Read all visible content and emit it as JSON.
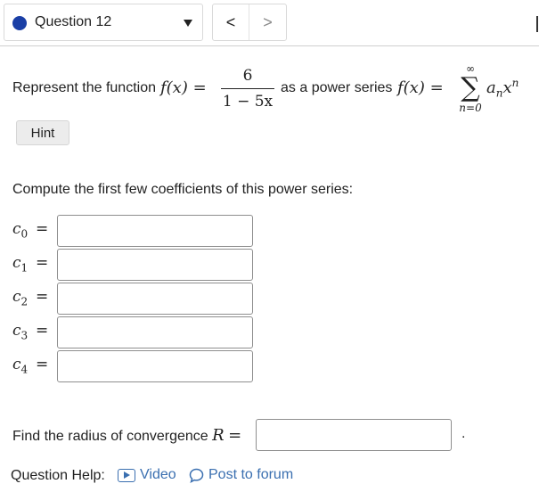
{
  "question_nav": {
    "status_color": "#1a3fa6",
    "label": "Question 12",
    "prev_symbol": "<",
    "next_symbol": ">"
  },
  "problem": {
    "prompt_prefix": "Represent the function",
    "f_of_x": "f(x) =",
    "fraction_numerator": "6",
    "fraction_denominator": "1 − 5x",
    "prompt_middle": "as a power series",
    "f_of_x_2": "f(x) =",
    "sum_upper": "∞",
    "sum_symbol": "∑",
    "sum_lower": "n=0",
    "term": "a",
    "term_sub": "n",
    "term_x": "x",
    "term_sup": "n"
  },
  "hint": {
    "label": "Hint"
  },
  "coefficients": {
    "instruction": "Compute the first few coefficients of this power series:",
    "items": [
      {
        "symbol": "c",
        "sub": "0",
        "eq": "=",
        "value": ""
      },
      {
        "symbol": "c",
        "sub": "1",
        "eq": "=",
        "value": ""
      },
      {
        "symbol": "c",
        "sub": "2",
        "eq": "=",
        "value": ""
      },
      {
        "symbol": "c",
        "sub": "3",
        "eq": "=",
        "value": ""
      },
      {
        "symbol": "c",
        "sub": "4",
        "eq": "=",
        "value": ""
      }
    ]
  },
  "radius": {
    "prompt": "Find the radius of convergence",
    "var": "R",
    "eq": "=",
    "value": "",
    "trailing": "."
  },
  "help": {
    "label": "Question Help:",
    "video": "Video",
    "forum": "Post to forum",
    "link_color": "#3a6fb0",
    "icons": [
      "video-icon",
      "chat-bubble-icon"
    ]
  }
}
